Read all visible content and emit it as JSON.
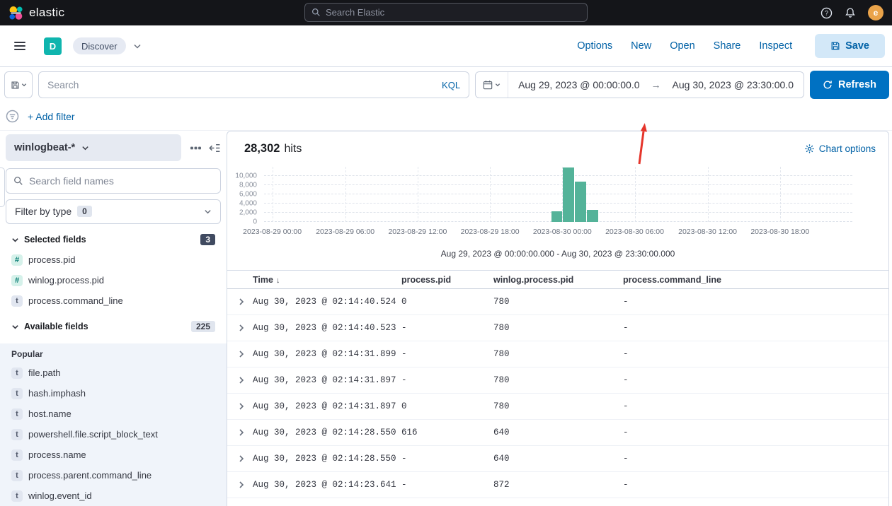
{
  "header": {
    "brand": "elastic",
    "search_placeholder": "Search Elastic",
    "avatar_initial": "e"
  },
  "nav": {
    "app_initial": "D",
    "breadcrumb": "Discover",
    "links": [
      {
        "label": "Options"
      },
      {
        "label": "New"
      },
      {
        "label": "Open"
      },
      {
        "label": "Share"
      },
      {
        "label": "Inspect"
      }
    ],
    "save_label": "Save"
  },
  "query": {
    "search_placeholder": "Search",
    "language_label": "KQL",
    "date_start": "Aug 29, 2023 @ 00:00:00.0",
    "date_separator": "→",
    "date_end": "Aug 30, 2023 @ 23:30:00.0",
    "refresh_label": "Refresh",
    "add_filter_label": "+ Add filter"
  },
  "sidebar": {
    "data_view": "winlogbeat-*",
    "field_search_placeholder": "Search field names",
    "filter_by_type_label": "Filter by type",
    "filter_by_type_count": "0",
    "selected": {
      "label": "Selected fields",
      "count": "3",
      "items": [
        {
          "icon": "#",
          "type": "num",
          "name": "process.pid"
        },
        {
          "icon": "#",
          "type": "num",
          "name": "winlog.process.pid"
        },
        {
          "icon": "t",
          "type": "str",
          "name": "process.command_line"
        }
      ]
    },
    "available": {
      "label": "Available fields",
      "count": "225",
      "group": "Popular",
      "items": [
        {
          "icon": "t",
          "type": "str",
          "name": "file.path"
        },
        {
          "icon": "t",
          "type": "str",
          "name": "hash.imphash"
        },
        {
          "icon": "t",
          "type": "str",
          "name": "host.name"
        },
        {
          "icon": "t",
          "type": "str",
          "name": "powershell.file.script_block_text"
        },
        {
          "icon": "t",
          "type": "str",
          "name": "process.name"
        },
        {
          "icon": "t",
          "type": "str",
          "name": "process.parent.command_line"
        },
        {
          "icon": "t",
          "type": "str",
          "name": "winlog.event_id"
        }
      ]
    }
  },
  "results": {
    "hits_value": "28,302",
    "hits_label": "hits",
    "chart_options_label": "Chart options",
    "range_subtitle": "Aug 29, 2023 @ 00:00:00.000 - Aug 30, 2023 @ 23:30:00.000"
  },
  "chart_data": {
    "type": "bar",
    "title": "",
    "xlabel": "",
    "ylabel": "",
    "legend": false,
    "grid": "dashed",
    "bar_color": "#54b399",
    "ymax": 12000,
    "x_range": [
      "2023-08-29 00:00",
      "2023-08-30 23:30"
    ],
    "yticks": [
      {
        "label": "10,000",
        "value": 10000
      },
      {
        "label": "8,000",
        "value": 8000
      },
      {
        "label": "6,000",
        "value": 6000
      },
      {
        "label": "4,000",
        "value": 4000
      },
      {
        "label": "2,000",
        "value": 2000
      },
      {
        "label": "0",
        "value": 0
      }
    ],
    "xticks": [
      {
        "label": "2023-08-29 00:00",
        "frac": 0.014
      },
      {
        "label": "2023-08-29 06:00",
        "frac": 0.138
      },
      {
        "label": "2023-08-29 12:00",
        "frac": 0.261
      },
      {
        "label": "2023-08-29 18:00",
        "frac": 0.384
      },
      {
        "label": "2023-08-30 00:00",
        "frac": 0.507
      },
      {
        "label": "2023-08-30 06:00",
        "frac": 0.63
      },
      {
        "label": "2023-08-30 12:00",
        "frac": 0.754
      },
      {
        "label": "2023-08-30 18:00",
        "frac": 0.877
      }
    ],
    "bars": [
      {
        "time": "2023-08-29 23:00",
        "value": 2300,
        "frac": 0.488
      },
      {
        "time": "2023-08-30 00:00",
        "value": 11800,
        "frac": 0.508
      },
      {
        "time": "2023-08-30 01:00",
        "value": 8800,
        "frac": 0.528
      },
      {
        "time": "2023-08-30 02:00",
        "value": 2600,
        "frac": 0.549
      }
    ],
    "bar_width_frac": 0.019
  },
  "table": {
    "sort_indicator": "↓",
    "columns": [
      {
        "label": "Time"
      },
      {
        "label": "process.pid"
      },
      {
        "label": "winlog.process.pid"
      },
      {
        "label": "process.command_line"
      }
    ],
    "rows": [
      {
        "time": "Aug 30, 2023 @ 02:14:40.524",
        "process_pid": "0",
        "winlog_process_pid": "780",
        "process_command_line": "-"
      },
      {
        "time": "Aug 30, 2023 @ 02:14:40.523",
        "process_pid": "-",
        "winlog_process_pid": "780",
        "process_command_line": "-"
      },
      {
        "time": "Aug 30, 2023 @ 02:14:31.899",
        "process_pid": "-",
        "winlog_process_pid": "780",
        "process_command_line": "-"
      },
      {
        "time": "Aug 30, 2023 @ 02:14:31.897",
        "process_pid": "-",
        "winlog_process_pid": "780",
        "process_command_line": "-"
      },
      {
        "time": "Aug 30, 2023 @ 02:14:31.897",
        "process_pid": "0",
        "winlog_process_pid": "780",
        "process_command_line": "-"
      },
      {
        "time": "Aug 30, 2023 @ 02:14:28.550",
        "process_pid": "616",
        "winlog_process_pid": "640",
        "process_command_line": "-"
      },
      {
        "time": "Aug 30, 2023 @ 02:14:28.550",
        "process_pid": "-",
        "winlog_process_pid": "640",
        "process_command_line": "-"
      },
      {
        "time": "Aug 30, 2023 @ 02:14:23.641",
        "process_pid": "-",
        "winlog_process_pid": "872",
        "process_command_line": "-"
      }
    ]
  },
  "annotation": {
    "color": "#e5352b"
  }
}
